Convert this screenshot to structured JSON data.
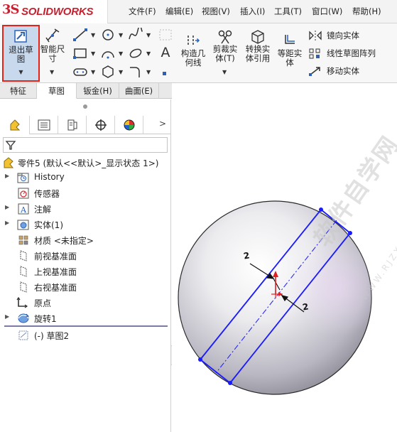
{
  "app": {
    "logo_prefix": "3S",
    "logo_text": "SOLIDWORKS"
  },
  "menu": [
    "文件(F)",
    "编辑(E)",
    "视图(V)",
    "插入(I)",
    "工具(T)",
    "窗口(W)",
    "帮助(H)"
  ],
  "toolbar": {
    "exit_sketch": {
      "line1": "退出草",
      "line2": "图"
    },
    "smart_dim": {
      "line1": "智能尺",
      "line2": "寸"
    },
    "construct_geom": {
      "line1": "构造几",
      "line2": "何线"
    },
    "trim_entities": {
      "line1": "剪裁实",
      "line2": "体(T)"
    },
    "convert_entities": {
      "line1": "转换实",
      "line2": "体引用"
    },
    "offset_entities": {
      "line1": "等距实",
      "line2": "体"
    },
    "mirror": "镜向实体",
    "linear_pattern": "线性草图阵列",
    "move_entities": "移动实体",
    "text_tool": "A"
  },
  "tabs": [
    "特征",
    "草图",
    "钣金(H)",
    "曲面(E)"
  ],
  "active_tab": "草图",
  "tree": {
    "root": "零件5  (默认<<默认>_显示状态 1>)",
    "items": [
      {
        "label": "History",
        "expandable": true,
        "icon": "history-icon"
      },
      {
        "label": "传感器",
        "expandable": false,
        "icon": "sensor-icon"
      },
      {
        "label": "注解",
        "expandable": true,
        "icon": "annotation-icon"
      },
      {
        "label": "实体(1)",
        "expandable": true,
        "icon": "solid-body-icon"
      },
      {
        "label": "材质 <未指定>",
        "expandable": false,
        "icon": "material-icon"
      },
      {
        "label": "前视基准面",
        "expandable": false,
        "icon": "plane-icon"
      },
      {
        "label": "上视基准面",
        "expandable": false,
        "icon": "plane-icon"
      },
      {
        "label": "右视基准面",
        "expandable": false,
        "icon": "plane-icon"
      },
      {
        "label": "原点",
        "expandable": false,
        "icon": "origin-icon"
      },
      {
        "label": "旋转1",
        "expandable": true,
        "icon": "revolve-icon"
      },
      {
        "label": "(-) 草图2",
        "expandable": false,
        "icon": "sketch-icon"
      }
    ]
  },
  "graphics": {
    "dimension_top": "2",
    "dimension_bottom": "2",
    "sketch_color": "#1a1aff",
    "watermark_main": "软件自学网",
    "watermark_url": "WWW.RJZXW.COM"
  },
  "colors": {
    "accent_red": "#e2231a",
    "brand_red": "#c8202e",
    "selection_blue": "#c8d9ee"
  }
}
